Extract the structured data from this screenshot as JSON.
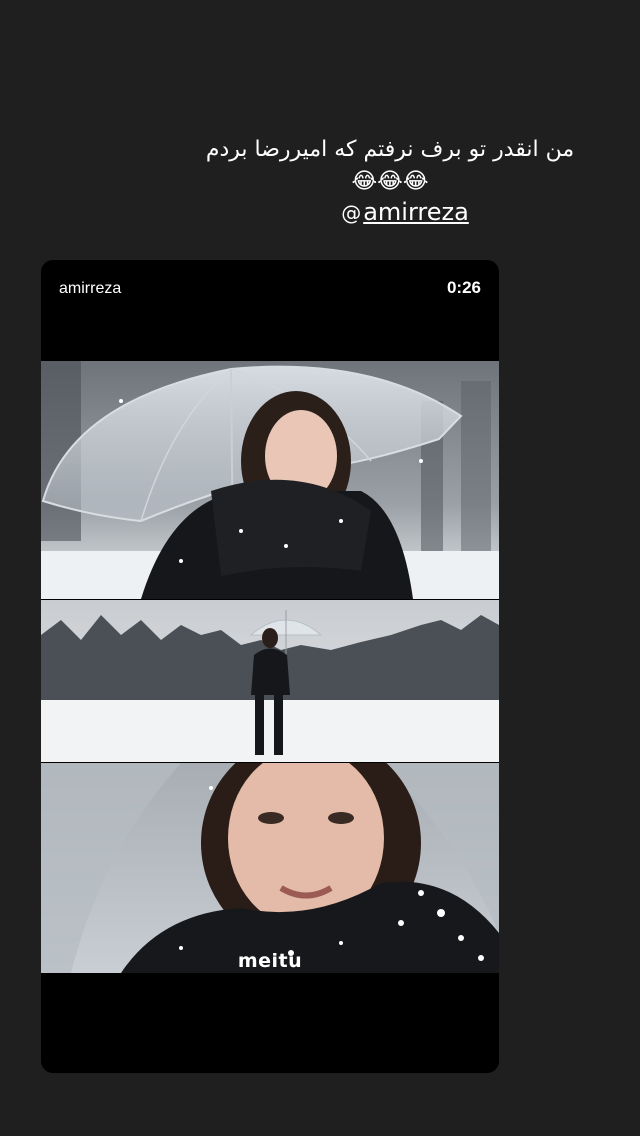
{
  "story": {
    "caption_line_1": "من انقدر تو برف نرفتم که امیررضا بردم",
    "caption_line_2": "😂😂😂",
    "mention_icon": "threads-icon",
    "mention_icon_glyph": "@",
    "mention_text": "amirreza"
  },
  "card": {
    "username": "amirreza",
    "duration": "0:26",
    "watermark": "meitu"
  },
  "colors": {
    "background": "#1f1f1f",
    "card": "#000000",
    "text": "#ffffff"
  }
}
